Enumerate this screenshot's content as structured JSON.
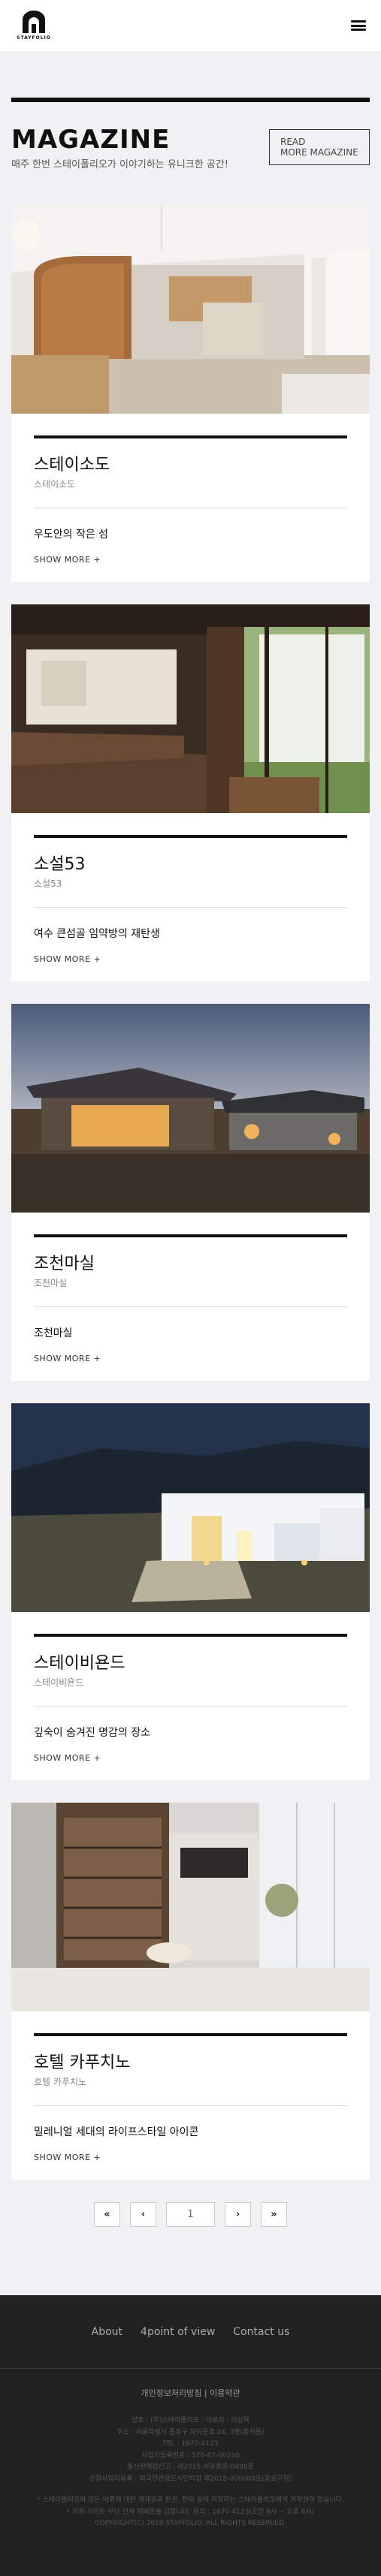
{
  "header": {
    "logo_text": "STAYFOLIO",
    "menu_icon": "hamburger-icon"
  },
  "hero": {
    "title": "MAGAZINE",
    "subtitle": "매주 한번 스테이폴리오가 이야기하는 유니크한 공간!",
    "read_more_line1": "READ",
    "read_more_line2": "MORE MAGAZINE"
  },
  "cards": [
    {
      "title": "스테이소도",
      "subtitle": "스테이소도",
      "description": "우도안의 작은 섬",
      "more": "SHOW MORE +"
    },
    {
      "title": "소설53",
      "subtitle": "소설53",
      "description": "여수 큰섬골 임약방의 재탄생",
      "more": "SHOW MORE +"
    },
    {
      "title": "조천마실",
      "subtitle": "조천마실",
      "description": "조천마실",
      "more": "SHOW MORE +"
    },
    {
      "title": "스테이비욘드",
      "subtitle": "스테이비욘드",
      "description": "깊숙이 숨겨진 명감의 장소",
      "more": "SHOW MORE +"
    },
    {
      "title": "호텔 카푸치노",
      "subtitle": "호텔 카푸치노",
      "description": "밀레니얼 세대의 라이프스타일 아이콘",
      "more": "SHOW MORE +"
    }
  ],
  "pagination": {
    "first": "«",
    "prev": "‹",
    "current": "1",
    "next": "›",
    "last": "»"
  },
  "footer": {
    "nav": [
      "About",
      "4point of view",
      "Contact us"
    ],
    "links": "개인정보처리방침 | 이용약관",
    "info": [
      "상호 : (주)스테이폴리오 · 대표자 : 이상묵",
      "주소 : 서울특별시 종로구 자하문로 24, 3층(통의동)",
      "TEL : 1670-4123",
      "사업자등록번호 : 570-87-00230",
      "통신판매업신고 : 제2015-서울종로-0499호",
      "관광사업자등록 : 외국인관광도시민박업 제2018-000000호(종로구청)"
    ],
    "notice": [
      "* 스테이폴리오와 모든 어휘에 대한 게재권과 판권, 판매 등에 저작하는 스테이폴리오에게 저작권이 있습니다.",
      "* 저희 사이트 무단 전재 재배포를 금합니다. 문의 : 1670-4123(오전 9시 ~ 오후 6시)",
      "COPYRIGHT(C) 2019 STAYFOLIO. ALL RIGHTS RESERVED."
    ]
  },
  "colors": {
    "background": "#f1f1f3",
    "footer": "#222222",
    "accent": "#111111"
  }
}
